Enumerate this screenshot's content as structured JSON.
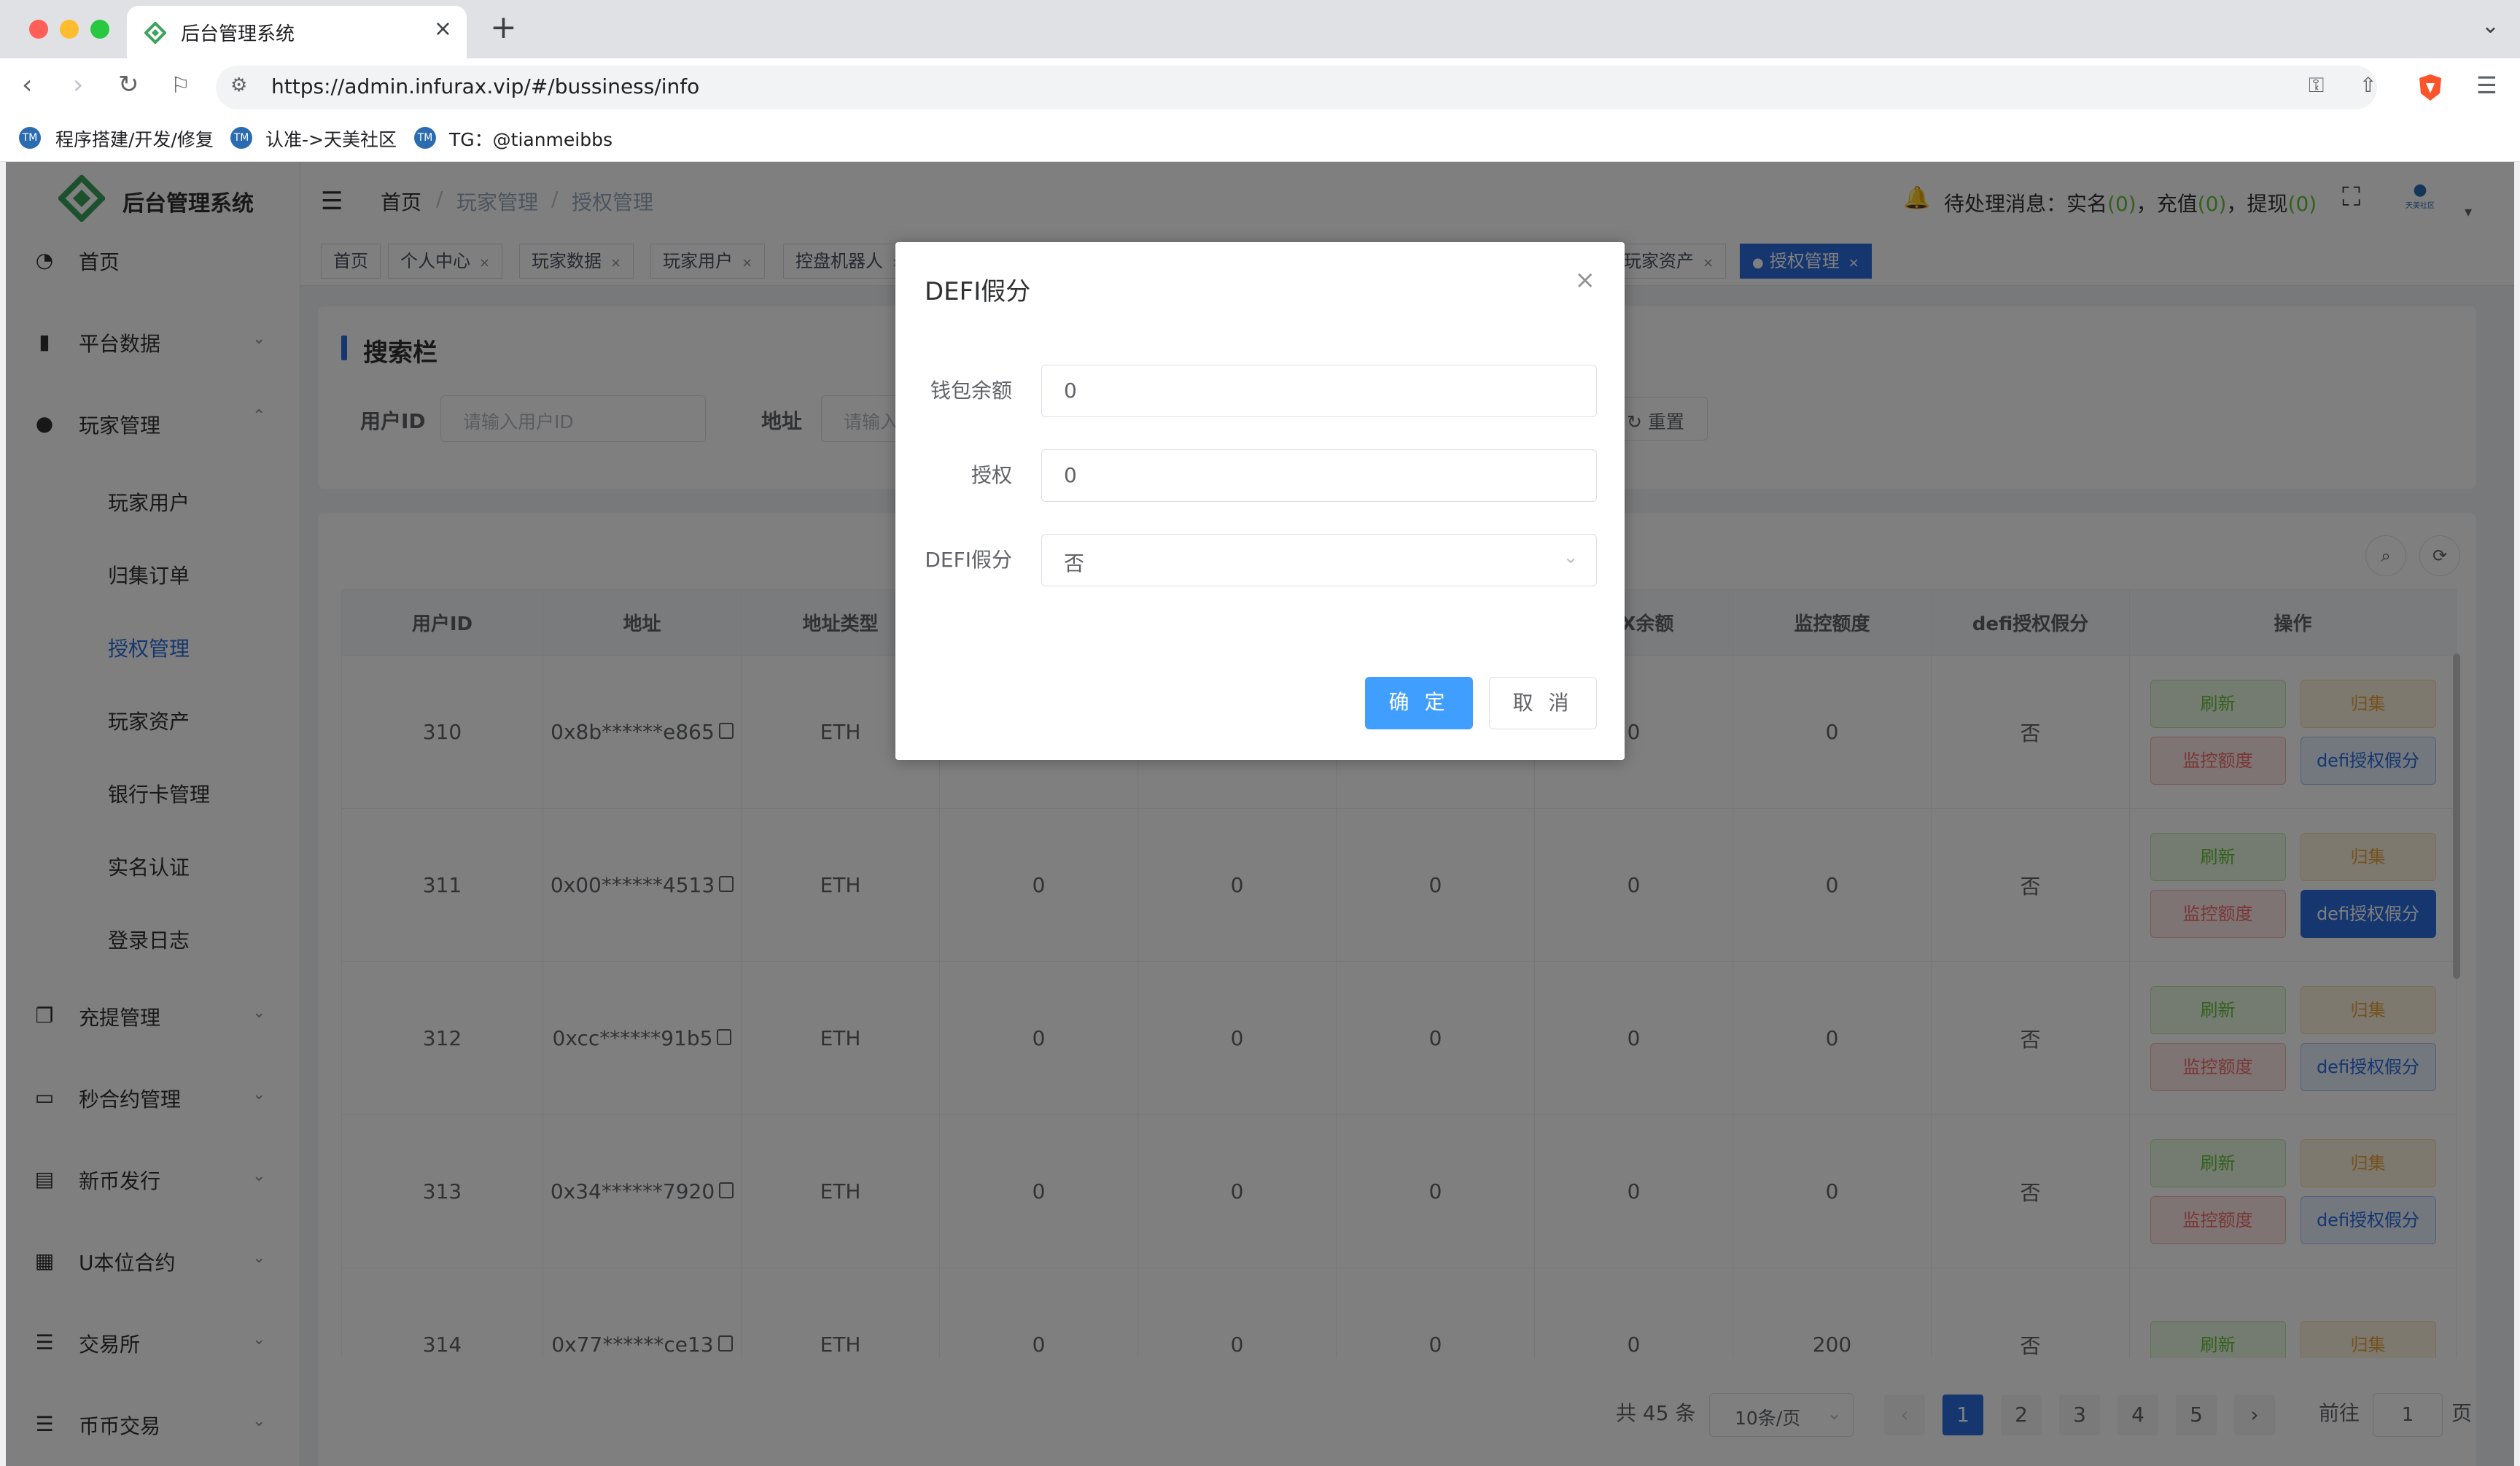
{
  "browser": {
    "tab_title": "后台管理系统",
    "url": "https://admin.infurax.vip/#/bussiness/info",
    "bookmarks": [
      "程序搭建/开发/修复",
      "认准->天美社区",
      "TG：@tianmeibbs"
    ]
  },
  "app": {
    "title": "后台管理系统",
    "breadcrumb": [
      "首页",
      "玩家管理",
      "授权管理"
    ],
    "notifications": {
      "label": "待处理消息：",
      "items": [
        {
          "name": "实名",
          "count": "0"
        },
        {
          "name": "充值",
          "count": "0"
        },
        {
          "name": "提现",
          "count": "0"
        }
      ]
    },
    "avatar_text": "天美社区"
  },
  "sidebar": {
    "items": [
      {
        "label": "首页",
        "icon": "dashboard-icon"
      },
      {
        "label": "平台数据",
        "icon": "book-icon"
      },
      {
        "label": "玩家管理",
        "icon": "user-icon"
      },
      {
        "label": "充提管理",
        "icon": "copy-icon"
      },
      {
        "label": "秒合约管理",
        "icon": "monitor-icon"
      },
      {
        "label": "新币发行",
        "icon": "news-icon"
      },
      {
        "label": "U本位合约",
        "icon": "grid-icon"
      },
      {
        "label": "交易所",
        "icon": "list-icon"
      },
      {
        "label": "币币交易",
        "icon": "list-icon"
      }
    ],
    "sub_items": [
      "玩家用户",
      "归集订单",
      "授权管理",
      "玩家资产",
      "银行卡管理",
      "实名认证",
      "登录日志"
    ]
  },
  "tags": [
    "首页",
    "个人中心",
    "玩家数据",
    "玩家用户",
    "控盘机器人",
    "玩家资产",
    "授权管理"
  ],
  "search": {
    "title": "搜索栏",
    "user_id_label": "用户ID",
    "user_id_placeholder": "请输入用户ID",
    "address_label": "地址",
    "address_placeholder": "请输入",
    "reset_label": "重置"
  },
  "table": {
    "columns": [
      "用户ID",
      "地址",
      "地址类型",
      "",
      "",
      "",
      "TRX余额",
      "监控额度",
      "defi授权假分",
      "操作"
    ],
    "rows": [
      {
        "id": "310",
        "address": "0x8b******e865",
        "type": "ETH",
        "c4": "",
        "c5": "",
        "c6": "",
        "trx": "0",
        "monitor": "0",
        "defi": "否"
      },
      {
        "id": "311",
        "address": "0x00******4513",
        "type": "ETH",
        "c4": "0",
        "c5": "0",
        "c6": "0",
        "trx": "0",
        "monitor": "0",
        "defi": "否"
      },
      {
        "id": "312",
        "address": "0xcc******91b5",
        "type": "ETH",
        "c4": "0",
        "c5": "0",
        "c6": "0",
        "trx": "0",
        "monitor": "0",
        "defi": "否"
      },
      {
        "id": "313",
        "address": "0x34******7920",
        "type": "ETH",
        "c4": "0",
        "c5": "0",
        "c6": "0",
        "trx": "0",
        "monitor": "0",
        "defi": "否"
      },
      {
        "id": "314",
        "address": "0x77******ce13",
        "type": "ETH",
        "c4": "0",
        "c5": "0",
        "c6": "0",
        "trx": "0",
        "monitor": "200",
        "defi": "否"
      }
    ],
    "actions": {
      "refresh": "刷新",
      "collect": "归集",
      "monitor": "监控额度",
      "defi": "defi授权假分"
    }
  },
  "pagination": {
    "total": "共 45 条",
    "page_size": "10条/页",
    "pages": [
      "1",
      "2",
      "3",
      "4",
      "5"
    ],
    "current": "1",
    "goto_label": "前往",
    "goto_value": "1",
    "goto_suffix": "页"
  },
  "dialog": {
    "title": "DEFI假分",
    "fields": [
      {
        "label": "钱包余额",
        "value": "0"
      },
      {
        "label": "授权",
        "value": "0"
      },
      {
        "label": "DEFI假分",
        "value": "否"
      }
    ],
    "confirm": "确 定",
    "cancel": "取 消"
  },
  "colors": {
    "primary": "#2b6cde",
    "success": "#67c23a",
    "warning": "#e6a23c",
    "danger": "#f56c6c"
  }
}
